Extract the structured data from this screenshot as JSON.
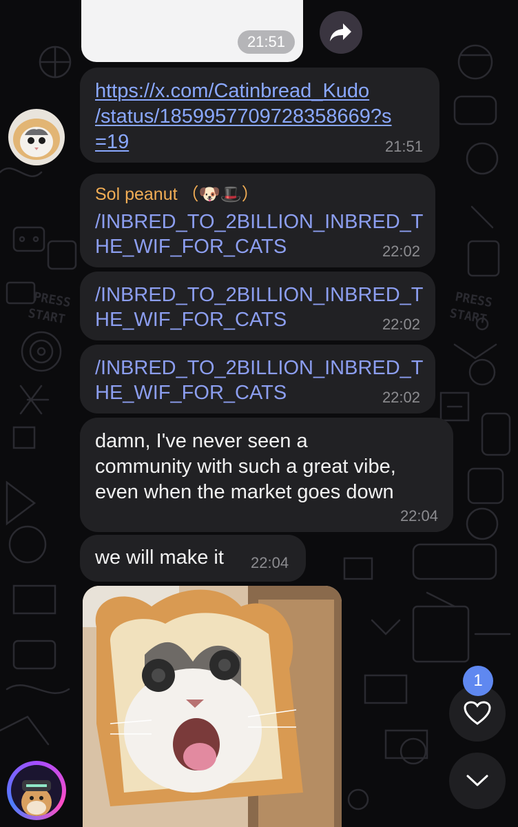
{
  "chat": {
    "messages": [
      {
        "id": "forwarded-preview",
        "time": "21:51"
      },
      {
        "id": "link-message",
        "lines": [
          "https://x.com/Catinbread_Kudo",
          "/status/1859957709728358669?s",
          "=19"
        ],
        "time": "21:51"
      },
      {
        "id": "cmd-1",
        "sender": "Sol peanut",
        "sender_suffix": "（🐶🎩）",
        "lines": [
          "/INBRED_TO_2BILLION_INBRED_T",
          "HE_WIF_FOR_CATS"
        ],
        "time": "22:02"
      },
      {
        "id": "cmd-2",
        "lines": [
          "/INBRED_TO_2BILLION_INBRED_T",
          "HE_WIF_FOR_CATS"
        ],
        "time": "22:02"
      },
      {
        "id": "cmd-3",
        "lines": [
          "/INBRED_TO_2BILLION_INBRED_T",
          "HE_WIF_FOR_CATS"
        ],
        "time": "22:02"
      },
      {
        "id": "text-1",
        "lines": [
          "damn, I've never seen a",
          "community with such a great vibe,",
          "even when the market goes down"
        ],
        "time": "22:04"
      },
      {
        "id": "text-2",
        "lines": [
          "we will make it"
        ],
        "time": "22:04"
      }
    ]
  },
  "reactions": {
    "count": "1"
  },
  "icons": {
    "share": "forward-arrow-icon",
    "heart": "heart-icon",
    "scroll_down": "chevron-down-icon"
  },
  "colors": {
    "background": "#0b0b0d",
    "bubble": "#212124",
    "link": "#8aa8ff",
    "sender_name": "#f1ad55",
    "badge": "#5f88f0"
  }
}
